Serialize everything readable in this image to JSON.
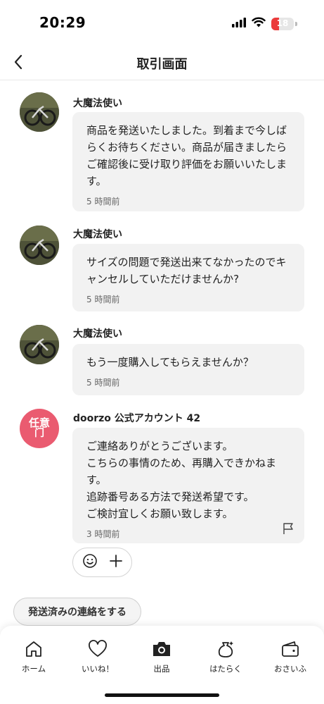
{
  "status_bar": {
    "time": "20:29",
    "battery_level": "18",
    "battery_color": "#eb3b3b",
    "icons": [
      "signal-icon",
      "wifi-icon",
      "battery-icon"
    ]
  },
  "header": {
    "title": "取引画面",
    "back_icon": "chevron-left-icon"
  },
  "messages": [
    {
      "sender": "大魔法使い",
      "text": "商品を発送いたしました。到着まで今しばらくお待ちください。商品が届きましたらご確認後に受け取り評価をお願いいたします。",
      "time": "5 時間前"
    },
    {
      "sender": "大魔法使い",
      "text": "サイズの問題で発送出来てなかったのでキャンセルしていただけませんか?",
      "time": "5 時間前"
    },
    {
      "sender": "大魔法使い",
      "text": "もう一度購入してもらえませんか？",
      "time": "5 時間前"
    },
    {
      "sender": "doorzo 公式アカウント 42",
      "text": "ご連絡ありがとうございます。\nこちらの事情のため、再購入できかねます。\n追跡番号ある方法で発送希望です。\nご検討宜しくお願い致します。",
      "time": "3 時間前",
      "avatar_text_line1": "任意",
      "avatar_text_line2": "门",
      "avatar_color": "#ea5b70"
    }
  ],
  "reaction_bar": {
    "icons": [
      "smiley-icon",
      "plus-icon"
    ]
  },
  "action_button": {
    "label": "発送済みの連絡をする"
  },
  "tab_bar": {
    "items": [
      {
        "label": "ホーム",
        "icon": "home-icon"
      },
      {
        "label": "いいね！",
        "icon": "heart-icon"
      },
      {
        "label": "出品",
        "icon": "camera-icon"
      },
      {
        "label": "はたらく",
        "icon": "money-bag-icon"
      },
      {
        "label": "おさいふ",
        "icon": "wallet-icon"
      }
    ]
  }
}
